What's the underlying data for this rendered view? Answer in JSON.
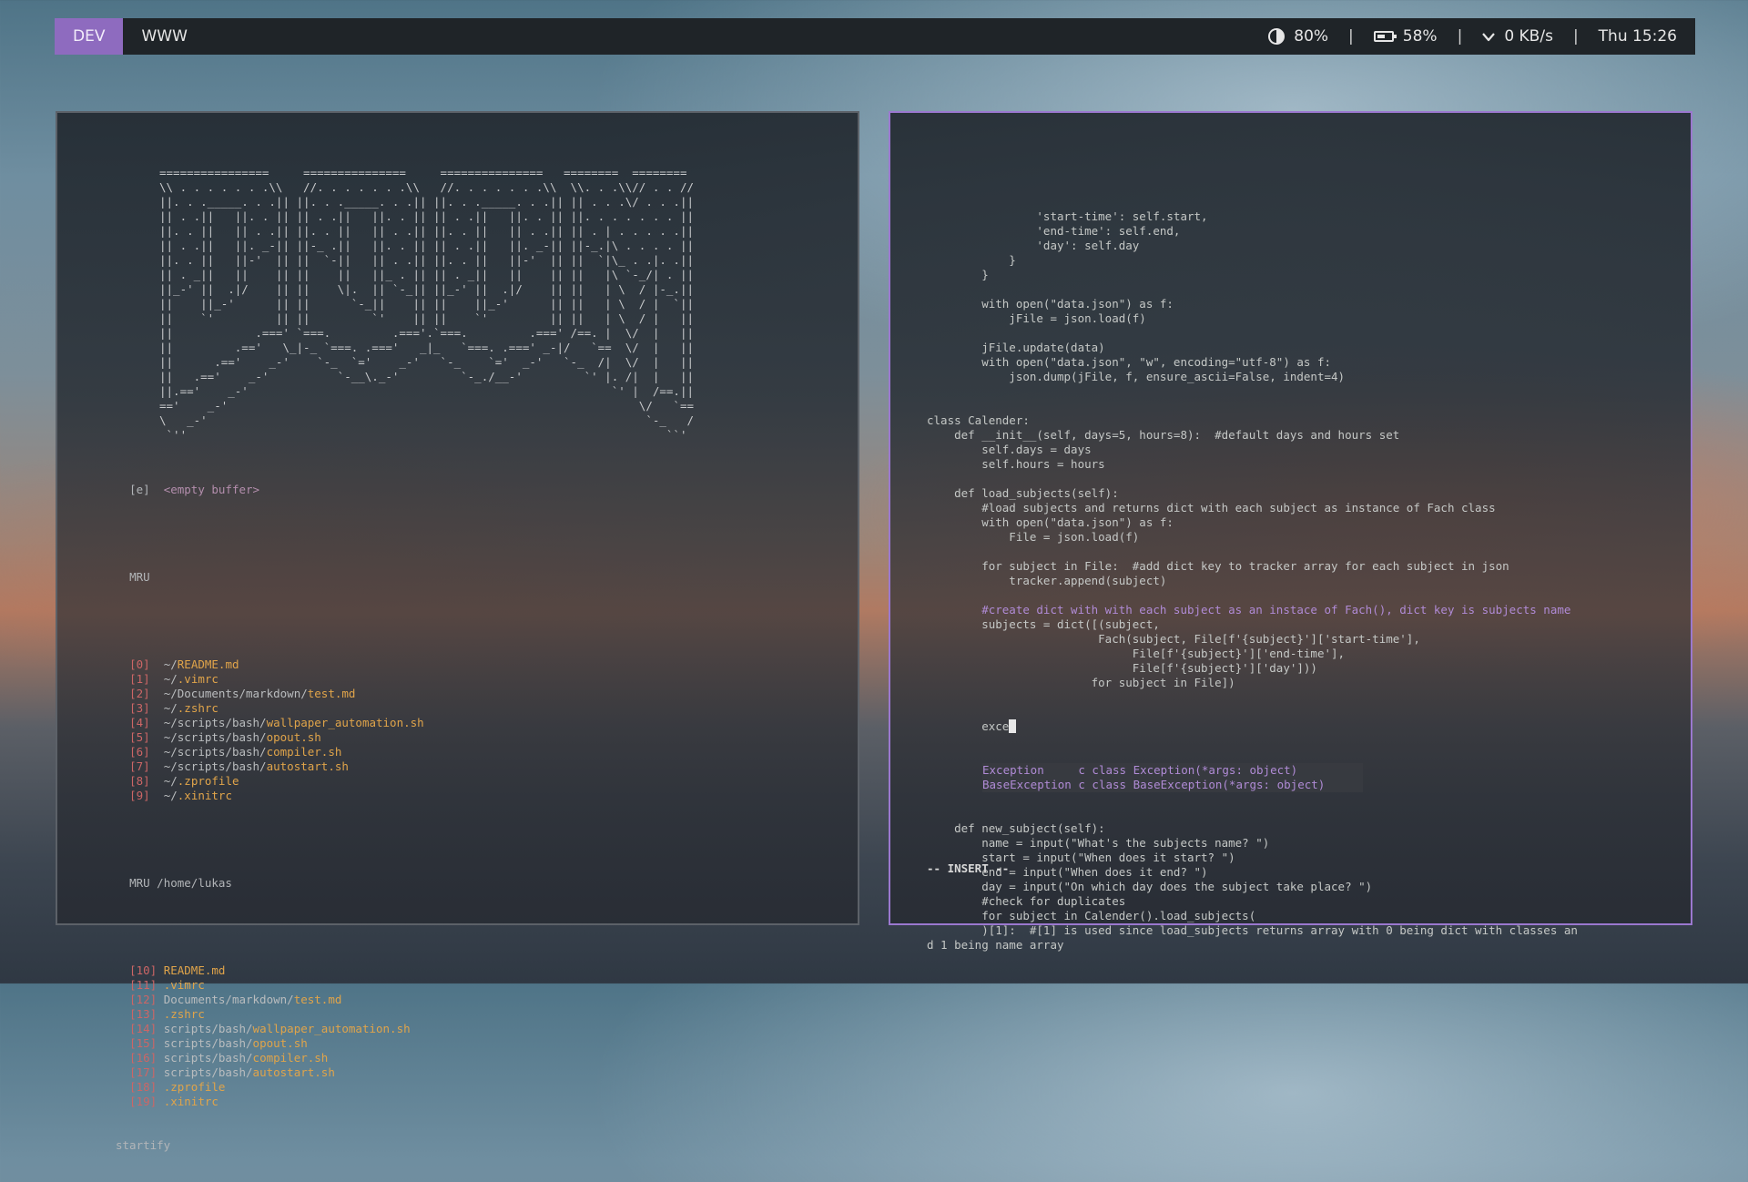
{
  "bar": {
    "workspaces": [
      "DEV",
      "WWW"
    ],
    "brightness": "80%",
    "battery": "58%",
    "battery_level": 0.58,
    "network": "0 KB/s",
    "clock": "Thu 15:26",
    "separator": "|",
    "icons": [
      "brightness-icon",
      "battery-icon",
      "wifi-icon"
    ]
  },
  "startify": {
    "art": [
      "================     ===============     ===============   ========  ========",
      "\\\\ . . . . . . .\\\\   //. . . . . . .\\\\   //. . . . . . .\\\\  \\\\. . .\\\\// . . //",
      "||. . ._____. . .|| ||. . ._____. . .|| ||. . ._____. . .|| || . . .\\/ . . .||",
      "|| . .||   ||. . || || . .||   ||. . || || . .||   ||. . || ||. . . . . . . ||",
      "||. . ||   || . .|| ||. . ||   || . .|| ||. . ||   || . .|| || . | . . . . .||",
      "|| . .||   ||. _-|| ||-_ .||   ||. . || || . .||   ||. _-|| ||-_.|\\ . . . . ||",
      "||. . ||   ||-'  || ||  `-||   || . .|| ||. . ||   ||-'  || ||  `|\\_ . .|. .||",
      "|| . _||   ||    || ||    ||   ||_ . || || . _||   ||    || ||   |\\ `-_/| . ||",
      "||_-' ||  .|/    || ||    \\|.  || `-_|| ||_-' ||  .|/    || ||   | \\  / |-_.||",
      "||    ||_-'      || ||      `-_||    || ||    ||_-'      || ||   | \\  / |  `||",
      "||    `'         || ||         `'    || ||    `'         || ||   | \\  / |   ||",
      "||            .===' `===.         .==='.`===.         .===' /==. |  \\/  |   ||",
      "||         .=='   \\_|-_ `===. .==='   _|_   `===. .===' _-|/   `==  \\/  |   ||",
      "||      .=='    _-'    `-_  `='    _-'   `-_    `='  _-'   `-_  /|  \\/  |   ||",
      "||   .=='    _-'          `-__\\._-'         `-_./__-'         `' |. /|  |   ||",
      "||.=='    _-'                                                     `' |  /==.||",
      "=='    _-'                                                            \\/   `==",
      "\\   _-'                                                                `-_   /",
      " `''                                                                      ``'"
    ],
    "buffer_index": "[e]",
    "buffer_label": "<empty buffer>",
    "mru_header": "MRU",
    "mru": [
      {
        "n": "[0]",
        "dir": "~/",
        "file": "README.md"
      },
      {
        "n": "[1]",
        "dir": "~/",
        "file": ".vimrc"
      },
      {
        "n": "[2]",
        "dir": "~/Documents/markdown/",
        "file": "test.md"
      },
      {
        "n": "[3]",
        "dir": "~/",
        "file": ".zshrc"
      },
      {
        "n": "[4]",
        "dir": "~/scripts/bash/",
        "file": "wallpaper_automation.sh"
      },
      {
        "n": "[5]",
        "dir": "~/scripts/bash/",
        "file": "opout.sh"
      },
      {
        "n": "[6]",
        "dir": "~/scripts/bash/",
        "file": "compiler.sh"
      },
      {
        "n": "[7]",
        "dir": "~/scripts/bash/",
        "file": "autostart.sh"
      },
      {
        "n": "[8]",
        "dir": "~/",
        "file": ".zprofile"
      },
      {
        "n": "[9]",
        "dir": "~/",
        "file": ".xinitrc"
      }
    ],
    "mru_home_header": "MRU /home/lukas",
    "mru_home": [
      {
        "n": "[10]",
        "dir": "",
        "file": "README.md"
      },
      {
        "n": "[11]",
        "dir": "",
        "file": ".vimrc"
      },
      {
        "n": "[12]",
        "dir": "Documents/markdown/",
        "file": "test.md"
      },
      {
        "n": "[13]",
        "dir": "",
        "file": ".zshrc"
      },
      {
        "n": "[14]",
        "dir": "scripts/bash/",
        "file": "wallpaper_automation.sh"
      },
      {
        "n": "[15]",
        "dir": "scripts/bash/",
        "file": "opout.sh"
      },
      {
        "n": "[16]",
        "dir": "scripts/bash/",
        "file": "compiler.sh"
      },
      {
        "n": "[17]",
        "dir": "scripts/bash/",
        "file": "autostart.sh"
      },
      {
        "n": "[18]",
        "dir": "",
        "file": ".zprofile"
      },
      {
        "n": "[19]",
        "dir": "",
        "file": ".xinitrc"
      }
    ],
    "footer": "startify"
  },
  "editor": {
    "lines": [
      {
        "t": "                'start-time': self.start,",
        "c": ""
      },
      {
        "t": "                'end-time': self.end,",
        "c": ""
      },
      {
        "t": "                'day': self.day",
        "c": ""
      },
      {
        "t": "            }",
        "c": ""
      },
      {
        "t": "        }",
        "c": ""
      },
      {
        "t": "",
        "c": ""
      },
      {
        "t": "        with open(\"data.json\") as f:",
        "c": ""
      },
      {
        "t": "            jFile = json.load(f)",
        "c": ""
      },
      {
        "t": "",
        "c": ""
      },
      {
        "t": "        jFile.update(data)",
        "c": ""
      },
      {
        "t": "        with open(\"data.json\", \"w\", encoding=\"utf-8\") as f:",
        "c": ""
      },
      {
        "t": "            json.dump(jFile, f, ensure_ascii=False, indent=4)",
        "c": ""
      },
      {
        "t": "",
        "c": ""
      },
      {
        "t": "",
        "c": ""
      },
      {
        "t": "class Calender:",
        "c": ""
      },
      {
        "t": "    def __init__(self, days=5, hours=8):  #default days and hours set",
        "c": ""
      },
      {
        "t": "        self.days = days",
        "c": ""
      },
      {
        "t": "        self.hours = hours",
        "c": ""
      },
      {
        "t": "",
        "c": ""
      },
      {
        "t": "    def load_subjects(self):",
        "c": ""
      },
      {
        "t": "        #load subjects and returns dict with each subject as instance of Fach class",
        "c": ""
      },
      {
        "t": "        with open(\"data.json\") as f:",
        "c": ""
      },
      {
        "t": "            File = json.load(f)",
        "c": ""
      },
      {
        "t": "",
        "c": ""
      },
      {
        "t": "        for subject in File:  #add dict key to tracker array for each subject in json",
        "c": ""
      },
      {
        "t": "            tracker.append(subject)",
        "c": ""
      },
      {
        "t": "",
        "c": ""
      },
      {
        "t": "        #create dict with with each subject as an instace of Fach(), dict key is subjects name",
        "c": "cm"
      },
      {
        "t": "        subjects = dict([(subject,",
        "c": ""
      },
      {
        "t": "                         Fach(subject, File[f'{subject}']['start-time'],",
        "c": ""
      },
      {
        "t": "                              File[f'{subject}']['end-time'],",
        "c": ""
      },
      {
        "t": "                              File[f'{subject}']['day']))",
        "c": ""
      },
      {
        "t": "                        for subject in File])",
        "c": ""
      }
    ],
    "current_line": "        exce",
    "completions": [
      {
        "word": "Exception    ",
        "kind": " c class Exception(*args: object)"
      },
      {
        "word": "BaseException",
        "kind": " c class BaseException(*args: object)"
      }
    ],
    "lines_after": [
      {
        "t": "    def new_subject(self):",
        "c": ""
      },
      {
        "t": "        name = input(\"What's the subjects name? \")",
        "c": ""
      },
      {
        "t": "        start = input(\"When does it start? \")",
        "c": ""
      },
      {
        "t": "        end = input(\"When does it end? \")",
        "c": ""
      },
      {
        "t": "        day = input(\"On which day does the subject take place? \")",
        "c": ""
      },
      {
        "t": "        #check for duplicates",
        "c": ""
      },
      {
        "t": "        for subject in Calender().load_subjects(",
        "c": ""
      },
      {
        "t": "        )[1]:  #[1] is used since load_subjects returns array with 0 being dict with classes an",
        "c": ""
      },
      {
        "t": "d 1 being name array",
        "c": ""
      }
    ],
    "mode": "-- INSERT --"
  }
}
